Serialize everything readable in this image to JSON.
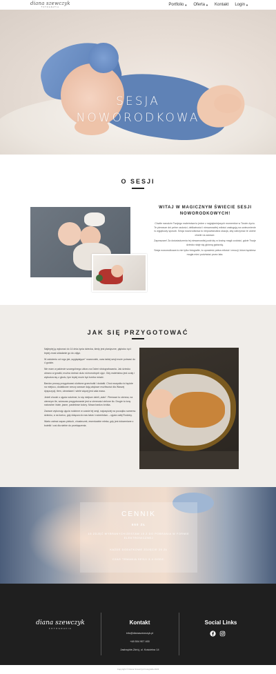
{
  "header": {
    "logo_script": "diana szewczyk",
    "logo_sub": "FOTOGRAFIA",
    "nav": [
      {
        "label": "Portfolio",
        "has_dropdown": true
      },
      {
        "label": "Oferta",
        "has_dropdown": true
      },
      {
        "label": "Kontakt",
        "has_dropdown": false
      },
      {
        "label": "Login",
        "has_dropdown": true
      }
    ]
  },
  "hero": {
    "title_line1": "SESJA",
    "title_line2": "NOWORODKOWA"
  },
  "about": {
    "title": "O SESJI",
    "heading": "WITAJ W MAGICZNYM ŚWIECIE SESJI NOWORODKOWYCH!",
    "paragraphs": [
      "Chwile narodzin Twojego maleństwa to jedne z najpiękniejszych momentów w Twoim życiu. Te pierwsze dni pełne czułości, delikatności i niesamowitej miłości zasługują na uwiecznienie w wyjątkowy sposób. Sesja noworodkowa to niepowtarzalna okazja, aby zatrzymać te ulotne chwile na zawsze.",
      "Zapraszam! Za doświadczenia tej niesamowitej podróży w krainę magii czułości, gdzie Twoje dziecko staje się główną gwiazdą.",
      "Sesja noworodkowa to nie tylko fotografie, to opowieść pełna miłości i emocji, która będziesz mogła mieć podziwiać przez lata."
    ]
  },
  "prep": {
    "title": "JAK SIĘ PRZYGOTOWAĆ",
    "paragraphs": [
      "Najlepiej ją wykonać do 14 dnia życia dziecka, kiedy jest plastyczne, głęboko śpi i lepiej znosi układanie go do zdjęć.",
      "W założeniu od rogu jak „wyglądające\" noworodek, czas takiej sesji może potrwać do 4 godzin.",
      "Nie mam w pakiecie szczególnego ubioru na Dzień sfotografowania. Jak dziecko ubrano w grzałki, można dobrać dużo różnorodnych ujęć. Gdy maleństwo jest czuły i wybudza się z głodu, tym lepiej może być trzeba mówić.",
      "Bardzo proszę przygotować ulubione grzechotki i dodatki. Choć wszystko to będzie na miejscu, dodatkowe rzeczy zawsze dają większe możliwości dla Waszej dyspozycji, tłem, ubrankami i wiele więcej jest cała masa.",
      "Jeżeli chodzi o ujęcia rodzinne, to się miejsce dzieli „ciało\". Pierwsze to ciemna, na ciemnym tle, wówczas przygotowanie jest w ciemności zielone tło. Drugie to tony naturalne: białe, jasne, pastelowe kolory. Mowa bardzo krótka.",
      "Zawsze wykonuję ujęcia rodzinne w czasie tej sesji, najczęściej na początku samemu dziecku, a na końcu, gdy dołącza do nas tatuś i rodzeństwo – ujęcia całej Rodziny.",
      "Warto zabrać zapas pieluch, chusteczek, ewentualnie mleka, gdy jest dokarmiane z butelki i coś dla siebie do przekąszenia."
    ]
  },
  "price": {
    "title": "CENNIK",
    "amount": "650 ZŁ",
    "lines": [
      "15 ZDJĘĆ WYBRANYCH/ZESTAW 15 Z DO POBRANIA W FORMIE ELEKTRONICZNEJ",
      "KAŻDE DODATKOWE ZDJĘCIE 25 ZŁ",
      "CZAS TRWANIA SESJI 3-4 GODZ."
    ]
  },
  "footer": {
    "logo_script": "diana szewczyk",
    "logo_sub": "FOTOGRAFIA",
    "contact_title": "Kontakt",
    "email": "info@dianaszewczyk.pl",
    "phone": "+48 504 907 400",
    "address": "Jastrzębie-Zdrój, ul. Kościelna 14",
    "social_title": "Social Links",
    "social_icons": [
      "facebook-icon",
      "instagram-icon"
    ],
    "copyright": "Copyright © Diana Szewczyk Fotografia 2023"
  },
  "colors": {
    "prep_bg": "#f0ede9",
    "footer_bg": "#1f1f1f",
    "hat_blue": "#5f82b6"
  }
}
